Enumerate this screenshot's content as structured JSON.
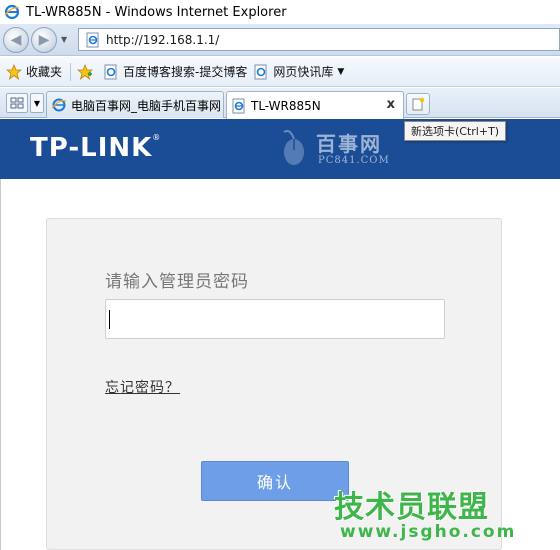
{
  "window": {
    "title": "TL-WR885N - Windows Internet Explorer"
  },
  "address_bar": {
    "url": "http://192.168.1.1/"
  },
  "favorites_bar": {
    "favorites_label": "收藏夹",
    "items": [
      {
        "label": "百度博客搜索-提交博客",
        "icon": "page-icon"
      },
      {
        "label": "网页快讯库",
        "icon": "feed-icon"
      }
    ]
  },
  "tabs": [
    {
      "label": "电脑百事网_电脑手机百事网",
      "active": false
    },
    {
      "label": "TL-WR885N",
      "active": true
    }
  ],
  "new_tab_tooltip": "新选项卡(Ctrl+T)",
  "page": {
    "logo": "TP-LINK",
    "logo_mark": "®",
    "watermark_name": "百事网",
    "watermark_url": "PC841.COM",
    "login": {
      "prompt": "请输入管理员密码",
      "password_value": "",
      "forgot_link": "忘记密码？",
      "confirm_button": "确认"
    }
  },
  "overlay_watermark": {
    "text": "技术员联盟",
    "url": "www.jsgho.com"
  },
  "colors": {
    "banner": "#1b4c96",
    "button": "#6f9ee8",
    "watermark": "#3fb64b"
  }
}
